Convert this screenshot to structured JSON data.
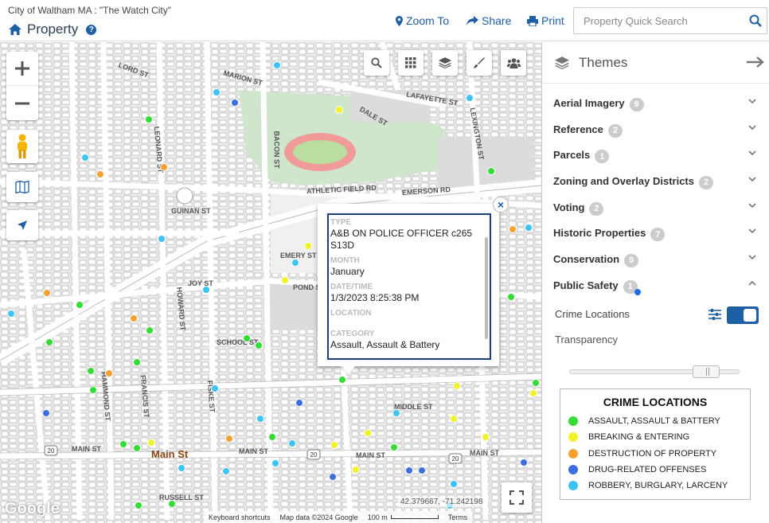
{
  "header": {
    "org": "City of Waltham MA : \"The Watch City\"",
    "app_title": "Property",
    "zoom_to": "Zoom To",
    "share": "Share",
    "print": "Print",
    "search_placeholder": "Property Quick Search"
  },
  "map": {
    "streets": {
      "lord_st": "LORD ST",
      "marion_st": "MARION ST",
      "lafayette_st": "LAFAYETTE ST",
      "dale_st": "DALE ST",
      "athletic_field_rd": "ATHLETIC FIELD RD",
      "emerson_rd": "EMERSON RD",
      "guinan_st": "GUINAN ST",
      "emery_st": "EMERY ST",
      "pond_st": "POND ST",
      "joy_st": "JOY ST",
      "school_st": "SCHOOL ST",
      "middle_st": "MIDDLE ST",
      "main_st": "MAIN ST",
      "russell_st": "RUSSELL ST",
      "bacon_st": "BACON ST",
      "lexington_st": "LEXINGTON ST",
      "hammond_st": "HAMMOND ST",
      "leonard_st": "LEONARD ST",
      "howard_st": "HOWARD ST",
      "fiske_st": "FISKE ST",
      "francis_st": "FRANCIS ST",
      "route_20": "20"
    },
    "main_st_poi": "Main St",
    "coords": "42.379667, -71.242198",
    "attribution": {
      "keyboard": "Keyboard shortcuts",
      "map_data": "Map data ©2024 Google",
      "scale": "100 m",
      "terms": "Terms"
    },
    "google_logo": "Google"
  },
  "popup": {
    "fields": [
      {
        "label": "TYPE",
        "value": "A&B ON POLICE OFFICER c265 S13D"
      },
      {
        "label": "MONTH",
        "value": "January"
      },
      {
        "label": "DATE/TIME",
        "value": "1/3/2023 8:25:38 PM"
      },
      {
        "label": "LOCATION",
        "value": ""
      },
      {
        "label": "CATEGORY",
        "value": "Assault, Assault & Battery"
      }
    ],
    "close": "×"
  },
  "sidebar": {
    "title": "Themes",
    "themes": [
      {
        "label": "Aerial Imagery",
        "count": "9",
        "expanded": false
      },
      {
        "label": "Reference",
        "count": "2",
        "expanded": false
      },
      {
        "label": "Parcels",
        "count": "1",
        "expanded": false
      },
      {
        "label": "Zoning and Overlay Districts",
        "count": "2",
        "expanded": false
      },
      {
        "label": "Voting",
        "count": "2",
        "expanded": false
      },
      {
        "label": "Historic Properties",
        "count": "7",
        "expanded": false
      },
      {
        "label": "Conservation",
        "count": "9",
        "expanded": false
      },
      {
        "label": "Public Safety",
        "count": "1",
        "expanded": true
      }
    ],
    "layer": {
      "label": "Crime Locations",
      "enabled": true
    },
    "transparency_label": "Transparency",
    "transparency_value": 0.8
  },
  "legend": {
    "title": "CRIME LOCATIONS",
    "items": [
      {
        "label": "ASSAULT, ASSAULT & BATTERY",
        "color": "#33dd33"
      },
      {
        "label": "BREAKING & ENTERING",
        "color": "#f2f22a"
      },
      {
        "label": "DESTRUCTION OF PROPERTY",
        "color": "#f5a030"
      },
      {
        "label": "DRUG-RELATED OFFENSES",
        "color": "#3b6fe0"
      },
      {
        "label": "ROBBERY, BURGLARY, LARCENY",
        "color": "#3cc4f5"
      }
    ]
  }
}
